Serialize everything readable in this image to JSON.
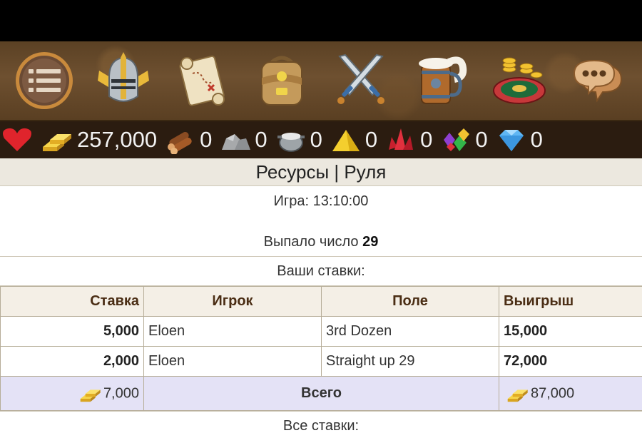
{
  "nav": {
    "icons": [
      "menu-icon",
      "knight-helmet-icon",
      "treasure-map-icon",
      "backpack-icon",
      "crossed-swords-icon",
      "beer-mug-icon",
      "roulette-icon",
      "chat-bubble-icon"
    ]
  },
  "resources": {
    "gold": "257,000",
    "wood": "0",
    "stone": "0",
    "iron": "0",
    "sulfur": "0",
    "crystal": "0",
    "gems": "0",
    "diamond": "0"
  },
  "page": {
    "title": "Ресурсы | Руля",
    "game_label": "Игра: 13:10:00",
    "drawn_label": "Выпало число",
    "drawn_number": "29",
    "your_bets": "Ваши ставки:",
    "all_bets": "Все ставки:"
  },
  "table": {
    "headers": [
      "Ставка",
      "Игрок",
      "Поле",
      "Выигрыш"
    ],
    "rows": [
      {
        "bet": "5,000",
        "player": "Eloen",
        "field": "3rd Dozen",
        "win": "15,000"
      },
      {
        "bet": "2,000",
        "player": "Eloen",
        "field": "Straight up 29",
        "win": "72,000"
      }
    ],
    "total": {
      "bet": "7,000",
      "label": "Всего",
      "win": "87,000"
    }
  },
  "colors": {
    "accent_gold": "#f2c230",
    "total_row": "#e4e2f6",
    "header_text": "#4a2d14"
  }
}
